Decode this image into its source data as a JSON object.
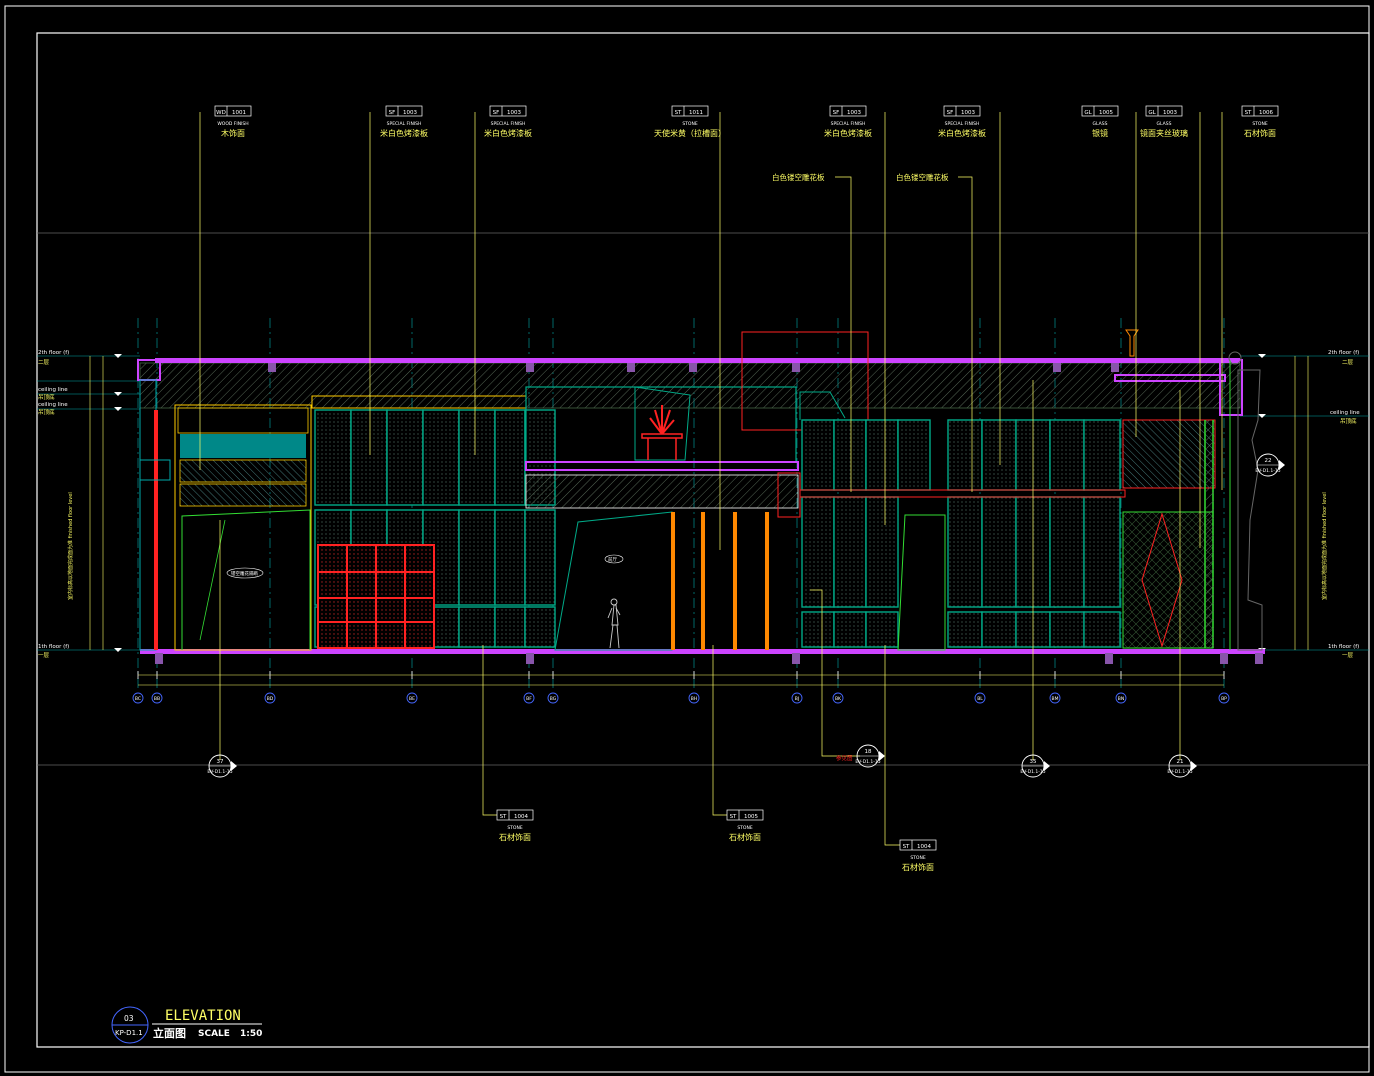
{
  "tags_top": [
    {
      "code": "WD",
      "num": "1001",
      "sub": "WOOD FINISH",
      "cn": "木饰面"
    },
    {
      "code": "SF",
      "num": "1003",
      "sub": "SPECIAL FINISH",
      "cn": "米白色烤漆板"
    },
    {
      "code": "SF",
      "num": "1003",
      "sub": "SPECIAL FINISH",
      "cn": "米白色烤漆板"
    },
    {
      "code": "ST",
      "num": "1011",
      "sub": "STONE",
      "cn": "天使米黄（拉槽面）"
    },
    {
      "code": "SF",
      "num": "1003",
      "sub": "SPECIAL FINISH",
      "cn": "米白色烤漆板"
    },
    {
      "code": "SF",
      "num": "1003",
      "sub": "SPECIAL FINISH",
      "cn": "米白色烤漆板"
    },
    {
      "code": "GL",
      "num": "1005",
      "sub": "GLASS",
      "cn": "银镜"
    },
    {
      "code": "GL",
      "num": "1003",
      "sub": "GLASS",
      "cn": "镜面夹丝玻璃"
    },
    {
      "code": "ST",
      "num": "1006",
      "sub": "STONE",
      "cn": "石材饰面"
    }
  ],
  "tags_mid": [
    "白色镂空雕花板",
    "白色镂空雕花板"
  ],
  "tags_bottom": [
    {
      "code": "ST",
      "num": "1004",
      "sub": "STONE",
      "cn": "石材饰面"
    },
    {
      "code": "ST",
      "num": "1005",
      "sub": "STONE",
      "cn": "石材饰面"
    },
    {
      "code": "ST",
      "num": "1004",
      "sub": "STONE",
      "cn": "石材饰面"
    }
  ],
  "grid_labels": [
    "BC",
    "BB",
    "BD",
    "BE",
    "BF",
    "BG",
    "BH",
    "BJ",
    "BK",
    "BL",
    "BM",
    "BN",
    "BP"
  ],
  "sections": [
    {
      "num": "37",
      "ref": "EV-D1.1-15"
    },
    {
      "num": "18",
      "ref": "EV-D1.1-15"
    },
    {
      "num": "35",
      "ref": "EV-D1.1-15"
    },
    {
      "num": "21",
      "ref": "EV-D1.1-15"
    },
    {
      "num": "22",
      "ref": "EV-D1.1-15"
    }
  ],
  "section_note": "参见图",
  "level_left": [
    "2th floor (f)",
    "ceiling line",
    "ceiling line",
    "1th floor (f)"
  ],
  "level_left_cn": [
    "二层",
    "吊顶底",
    "吊顶底",
    "一层"
  ],
  "level_right": [
    "2th floor (f)",
    "ceiling line",
    "1th floor (f)"
  ],
  "level_right_cn": [
    "二层",
    "吊顶底",
    "一层"
  ],
  "vertical_note": "室内标高以地面完成面为准 finished floor level",
  "room_labels": [
    "镂空雕花隔断",
    "前厅"
  ],
  "title": {
    "circle_top": "03",
    "circle_bottom": "KP-D1.1",
    "en": "ELEVATION",
    "cn": "立面图",
    "scale_label": "SCALE",
    "scale": "1:50"
  },
  "colors": {
    "bg": "#000000",
    "slab": "#cc44ff",
    "tag": "#ffff66",
    "cabinet": "#00aa88",
    "red": "#ff2222",
    "orange": "#ff8800",
    "green": "#33dd33",
    "cyan": "#00bbbb",
    "white": "#ffffff"
  }
}
